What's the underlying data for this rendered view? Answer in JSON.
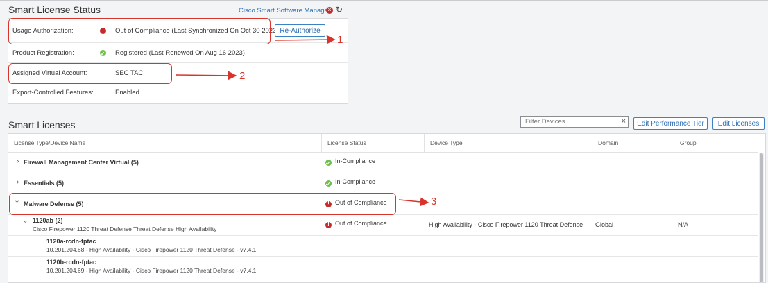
{
  "status_section": {
    "title": "Smart License Status",
    "manager_link": "Cisco Smart Software Manager",
    "rows": [
      {
        "label": "Usage Authorization:",
        "value": "Out of Compliance (Last Synchronized On Oct 30 2023)",
        "icon": "error-icon"
      },
      {
        "label": "Product Registration:",
        "value": "Registered (Last Renewed On Aug 16 2023)",
        "icon": "check-icon"
      },
      {
        "label": "Assigned Virtual Account:",
        "value": "SEC TAC"
      },
      {
        "label": "Export-Controlled Features:",
        "value": "Enabled"
      }
    ],
    "reauthorize_label": "Re-Authorize"
  },
  "licenses_section": {
    "title": "Smart Licenses",
    "filter_placeholder": "Filter Devices...",
    "edit_performance_tier": "Edit Performance Tier",
    "edit_licenses": "Edit Licenses",
    "columns": [
      "License Type/Device Name",
      "License Status",
      "Device Type",
      "Domain",
      "Group"
    ],
    "rows": [
      {
        "name": "Firewall Management Center Virtual (5)",
        "status": "In-Compliance"
      },
      {
        "name": "Essentials (5)",
        "status": "In-Compliance"
      },
      {
        "name": "Malware Defense (5)",
        "status": "Out of Compliance"
      }
    ],
    "group_row": {
      "name": "1120ab (2)",
      "subtitle": "Cisco Firepower 1120 Threat Defense Threat Defense High Availability",
      "status": "Out of Compliance",
      "device_type": "High Availability - Cisco Firepower 1120 Threat Defense",
      "domain": "Global",
      "group": "N/A"
    },
    "devices": [
      {
        "name": "1120a-rcdn-fptac",
        "detail": "10.201.204.68 - High Availability - Cisco Firepower 1120 Threat Defense - v7.4.1"
      },
      {
        "name": "1120b-rcdn-fptac",
        "detail": "10.201.204.69 - High Availability - Cisco Firepower 1120 Threat Defense - v7.4.1"
      }
    ]
  },
  "annotations": [
    "1",
    "2",
    "3"
  ],
  "colors": {
    "accent": "#2d6fb3",
    "error": "#c62b2b",
    "success": "#6cc04a",
    "annotation": "#d9342b"
  }
}
